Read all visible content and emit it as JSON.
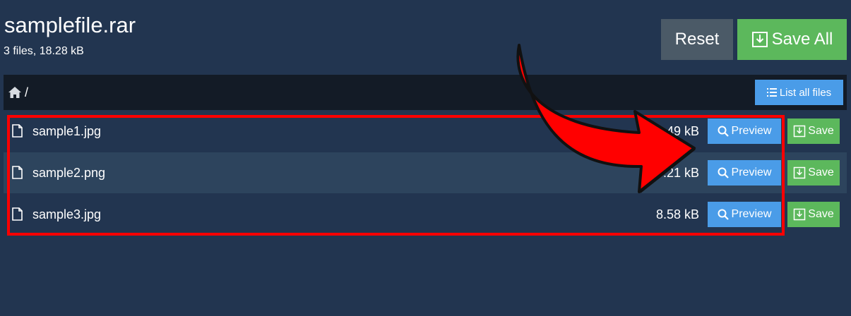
{
  "header": {
    "title": "samplefile.rar",
    "subtitle": "3 files, 18.28 kB"
  },
  "toolbar": {
    "reset_label": "Reset",
    "save_all_label": "Save All"
  },
  "pathbar": {
    "path": "/",
    "list_all_label": "List all files"
  },
  "files": [
    {
      "name": "sample1.jpg",
      "size": "4.49 kB",
      "preview_label": "Preview",
      "save_label": "Save"
    },
    {
      "name": "sample2.png",
      "size": "5.21 kB",
      "preview_label": "Preview",
      "save_label": "Save"
    },
    {
      "name": "sample3.jpg",
      "size": "8.58 kB",
      "preview_label": "Preview",
      "save_label": "Save"
    }
  ],
  "colors": {
    "background": "#223550",
    "row_alt": "#2d445d",
    "pathbar": "#131b26",
    "primary": "#4a9ce8",
    "success": "#5cb85c",
    "reset": "#4b5a67",
    "annotation": "#ff0000"
  },
  "icons": [
    "download-icon",
    "home-icon",
    "list-icon",
    "file-icon",
    "search-icon",
    "arrow-annotation"
  ]
}
